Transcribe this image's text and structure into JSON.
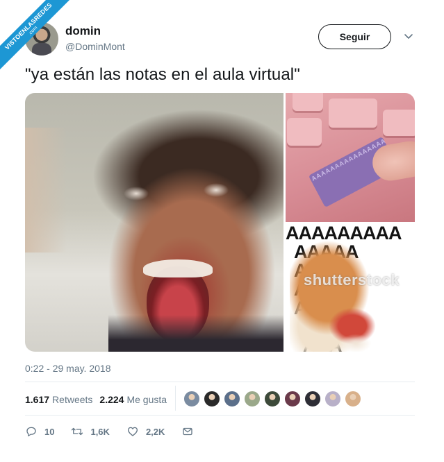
{
  "ribbon": {
    "line1": "VISTOENLASREDES",
    "line2": ".com"
  },
  "user": {
    "name": "domin",
    "handle": "@DominMont"
  },
  "follow_button": {
    "label": "Seguir"
  },
  "tweet": {
    "text": "\"ya están las notas en el aula virtual\""
  },
  "media": {
    "keyboard_text": "AAAAAAAAAAAAAAAAAAAAAAAAAAAAAAAAAAAAAAAAAAAAAAAAAAAAAAAAAAAAAAAAAAAAAAAAAAAA",
    "dog_text": "AAAAAAAAA\n  AAAAA\n  AAAA\n  AAAA\n  AAAA\n    AAAA\n    AAA",
    "watermark": "shutterstock"
  },
  "timestamp": "0:22 - 29 may. 2018",
  "stats": {
    "retweets_count": "1.617",
    "retweets_label": "Retweets",
    "likes_count": "2.224",
    "likes_label": "Me gusta"
  },
  "likers": [
    {
      "color": "#7a8ba0"
    },
    {
      "color": "#2a2a2a"
    },
    {
      "color": "#5b6f8a"
    },
    {
      "color": "#9aa88a"
    },
    {
      "color": "#3d4a3a"
    },
    {
      "color": "#6a3a4a"
    },
    {
      "color": "#2e2e36"
    },
    {
      "color": "#b8b0c8"
    },
    {
      "color": "#d8b08a"
    }
  ],
  "actions": {
    "reply_count": "10",
    "retweet_count": "1,6K",
    "like_count": "2,2K"
  },
  "colors": {
    "text": "#14171a",
    "muted": "#657786",
    "divider": "#e6ecf0",
    "ribbon": "#1d97d4"
  }
}
